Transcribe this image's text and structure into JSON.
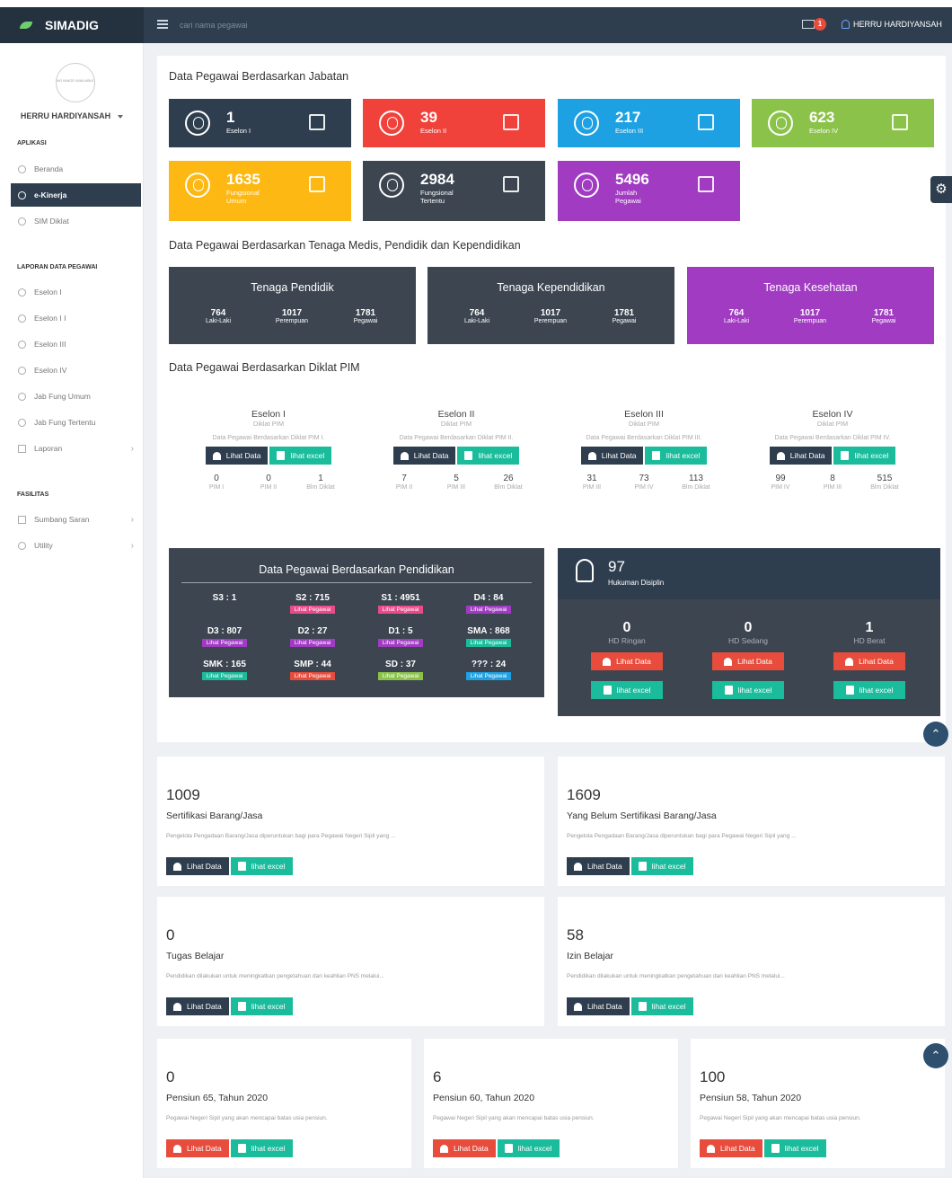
{
  "app": {
    "name": "SIMADIG",
    "search_placeholder": "cari nama pegawai",
    "mail_count": "1",
    "user": "HERRU HARDIYANSAH"
  },
  "sidebar": {
    "avatar_text": "NO IMAGE AVAILABLE",
    "user": "HERRU HARDIYANSAH",
    "section_app": "APLIKASI",
    "app_items": [
      "Beranda",
      "e-Kinerja",
      "SIM Diklat"
    ],
    "section_report": "LAPORAN DATA PEGAWAI",
    "report_items": [
      "Eselon I",
      "Eselon I I",
      "Eselon III",
      "Eselon IV",
      "Jab Fung Umum",
      "Jab Fung Tertentu",
      "Laporan"
    ],
    "section_facility": "FASILITAS",
    "facility_items": [
      "Sumbang Saran",
      "Utility"
    ]
  },
  "jabatan": {
    "title": "Data Pegawai Berdasarkan Jabatan",
    "cards": [
      {
        "value": "1",
        "label": "Eselon I",
        "color": "#2f3e4f"
      },
      {
        "value": "39",
        "label": "Eselon II",
        "color": "#f0423a"
      },
      {
        "value": "217",
        "label": "Eselon III",
        "color": "#1da1e2"
      },
      {
        "value": "623",
        "label": "Eselon IV",
        "color": "#8bc34a"
      },
      {
        "value": "1635",
        "label": "Fungsional Umum",
        "color": "#fdb813"
      },
      {
        "value": "2984",
        "label": "Fungsional Tertentu",
        "color": "#3c4550"
      },
      {
        "value": "5496",
        "label": "Jumlah Pegawai",
        "color": "#a03bc2"
      }
    ]
  },
  "tenaga": {
    "title": "Data Pegawai Berdasarkan Tenaga Medis, Pendidik dan Kependidikan",
    "cards": [
      {
        "title": "Tenaga Pendidik",
        "male": "764",
        "female": "1017",
        "total": "1781",
        "color": "#3c4550"
      },
      {
        "title": "Tenaga Kependidikan",
        "male": "764",
        "female": "1017",
        "total": "1781",
        "color": "#3c4550"
      },
      {
        "title": "Tenaga Kesehatan",
        "male": "764",
        "female": "1017",
        "total": "1781",
        "color": "#a03bc2"
      }
    ],
    "male_label": "Laki-Laki",
    "female_label": "Perempuan",
    "total_label": "Pegawai"
  },
  "diklat": {
    "title": "Data Pegawai Berdasarkan Diklat PIM",
    "subtitle": "Diklat PIM",
    "btn_data": "Lihat Data",
    "btn_excel": "lihat excel",
    "groups": [
      {
        "name": "Eselon I",
        "desc": "Data Pegawai Berdasarkan Diklat PIM I.",
        "vals": [
          [
            "0",
            "PIM I"
          ],
          [
            "0",
            "PIM II"
          ],
          [
            "1",
            "Blm Diklat"
          ]
        ]
      },
      {
        "name": "Eselon II",
        "desc": "Data Pegawai Berdasarkan Diklat PIM II.",
        "vals": [
          [
            "7",
            "PIM II"
          ],
          [
            "5",
            "PIM III"
          ],
          [
            "26",
            "Blm Diklat"
          ]
        ]
      },
      {
        "name": "Eselon III",
        "desc": "Data Pegawai Berdasarkan Diklat PIM III.",
        "vals": [
          [
            "31",
            "PIM III"
          ],
          [
            "73",
            "PIM IV"
          ],
          [
            "113",
            "Blm Diklat"
          ]
        ]
      },
      {
        "name": "Eselon IV",
        "desc": "Data Pegawai Berdasarkan Diklat PIM IV.",
        "vals": [
          [
            "99",
            "PIM IV"
          ],
          [
            "8",
            "PIM III"
          ],
          [
            "515",
            "Blm Diklat"
          ]
        ]
      }
    ]
  },
  "pendidikan": {
    "title": "Data Pegawai Berdasarkan Pendidikan",
    "tag": "Lihat Pegawai",
    "cells": [
      {
        "v": "S3 : 1",
        "c": ""
      },
      {
        "v": "S2 : 715",
        "c": "#e84c8b"
      },
      {
        "v": "S1 : 4951",
        "c": "#e84c8b"
      },
      {
        "v": "D4 : 84",
        "c": "#a03bc2"
      },
      {
        "v": "D3 : 807",
        "c": "#a03bc2"
      },
      {
        "v": "D2 : 27",
        "c": "#a03bc2"
      },
      {
        "v": "D1 : 5",
        "c": "#a03bc2"
      },
      {
        "v": "SMA : 868",
        "c": "#1abc9c"
      },
      {
        "v": "SMK : 165",
        "c": "#1abc9c"
      },
      {
        "v": "SMP : 44",
        "c": "#e74c3c"
      },
      {
        "v": "SD : 37",
        "c": "#8bc34a"
      },
      {
        "v": "??? : 24",
        "c": "#1da1e2"
      }
    ]
  },
  "disiplin": {
    "value": "97",
    "label": "Hukuman Disiplin",
    "cols": [
      {
        "v": "0",
        "l": "HD Ringan"
      },
      {
        "v": "0",
        "l": "HD Sedang"
      },
      {
        "v": "1",
        "l": "HD Berat"
      }
    ],
    "btn_data": "Lihat Data",
    "btn_excel": "lihat excel"
  },
  "cards": [
    {
      "num": "1009",
      "title": "Sertifikasi Barang/Jasa",
      "desc": "Pengelola Pengadaan Barang/Jasa diperuntukan bagi para Pegawai Negeri Sipil yang ..."
    },
    {
      "num": "1609",
      "title": "Yang Belum Sertifikasi Barang/Jasa",
      "desc": "Pengelola Pengadaan Barang/Jasa diperuntukan bagi para Pegawai Negeri Sipil yang ..."
    },
    {
      "num": "0",
      "title": "Tugas Belajar",
      "desc": "Pendidikan dilakukan untuk meningkatkan pengetahuan dan keahlian PNS melalui..."
    },
    {
      "num": "58",
      "title": "Izin Belajar",
      "desc": "Pendidikan dilakukan untuk meningkatkan pengetahuan dan keahlian PNS melalui..."
    },
    {
      "num": "0",
      "title": "Pensiun 65, Tahun 2020",
      "desc": "Pegawai Negeri Sipil yang akan mencapai batas usia pensiun."
    },
    {
      "num": "6",
      "title": "Pensiun 60, Tahun 2020",
      "desc": "Pegawai Negeri Sipil yang akan mencapai batas usia pensiun."
    },
    {
      "num": "100",
      "title": "Pensiun 58, Tahun 2020",
      "desc": "Pegawai Negeri Sipil yang akan mencapai batas usia pensiun."
    }
  ],
  "card_btn_data": "Lihat Data",
  "card_btn_excel": "lihat excel"
}
